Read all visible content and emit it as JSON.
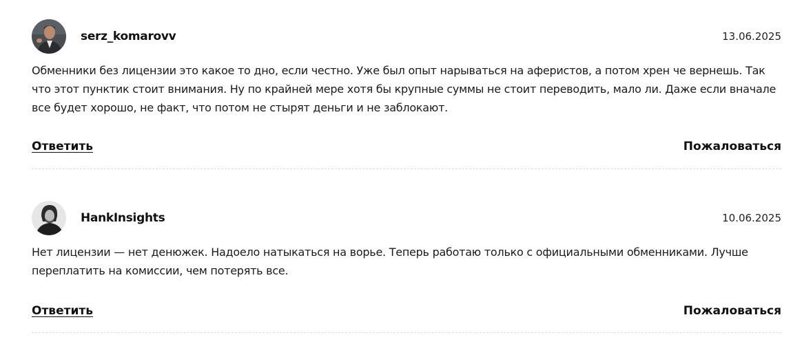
{
  "comments": [
    {
      "author": "serz_komarovv",
      "date": "13.06.2025",
      "text": "Обменники без лицензии это какое то дно, если честно. Уже был опыт нарываться на аферистов, а потом хрен че вернешь. Так что этот пунктик стоит внимания. Ну по крайней мере хотя бы крупные суммы не стоит переводить, мало ли. Даже если вначале все будет хорошо, не факт, что потом не стырят деньги и не заблокают.",
      "reply_label": "Ответить",
      "report_label": "Пожаловаться"
    },
    {
      "author": "HankInsights",
      "date": "10.06.2025",
      "text": "Нет лицензии — нет денюжек. Надоело натыкаться на ворье. Теперь работаю только с официальными обменниками. Лучше переплатить на комиссии, чем потерять все.",
      "reply_label": "Ответить",
      "report_label": "Пожаловаться"
    }
  ]
}
